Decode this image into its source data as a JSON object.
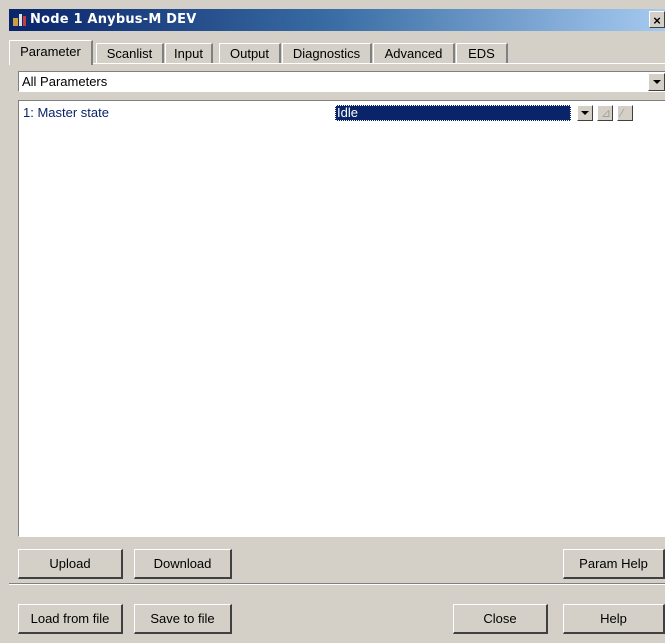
{
  "window": {
    "title": "Node 1 Anybus-M DEV",
    "close_label": "×"
  },
  "tabs": [
    {
      "label": "Parameter",
      "active": true
    },
    {
      "label": "Scanlist",
      "active": false
    },
    {
      "label": "Input",
      "active": false
    },
    {
      "label": "Output",
      "active": false
    },
    {
      "label": "Diagnostics",
      "active": false
    },
    {
      "label": "Advanced",
      "active": false
    },
    {
      "label": "EDS",
      "active": false
    }
  ],
  "group_selector": {
    "value": "All Parameters"
  },
  "parameters": [
    {
      "label": "1: Master state",
      "value": "Idle"
    }
  ],
  "buttons": {
    "upload": "Upload",
    "download": "Download",
    "param_help": "Param Help",
    "load_from_file": "Load from file",
    "save_to_file": "Save to file",
    "close": "Close",
    "help": "Help"
  },
  "colors": {
    "selection": "#0a246a",
    "face": "#d4d0c8"
  }
}
